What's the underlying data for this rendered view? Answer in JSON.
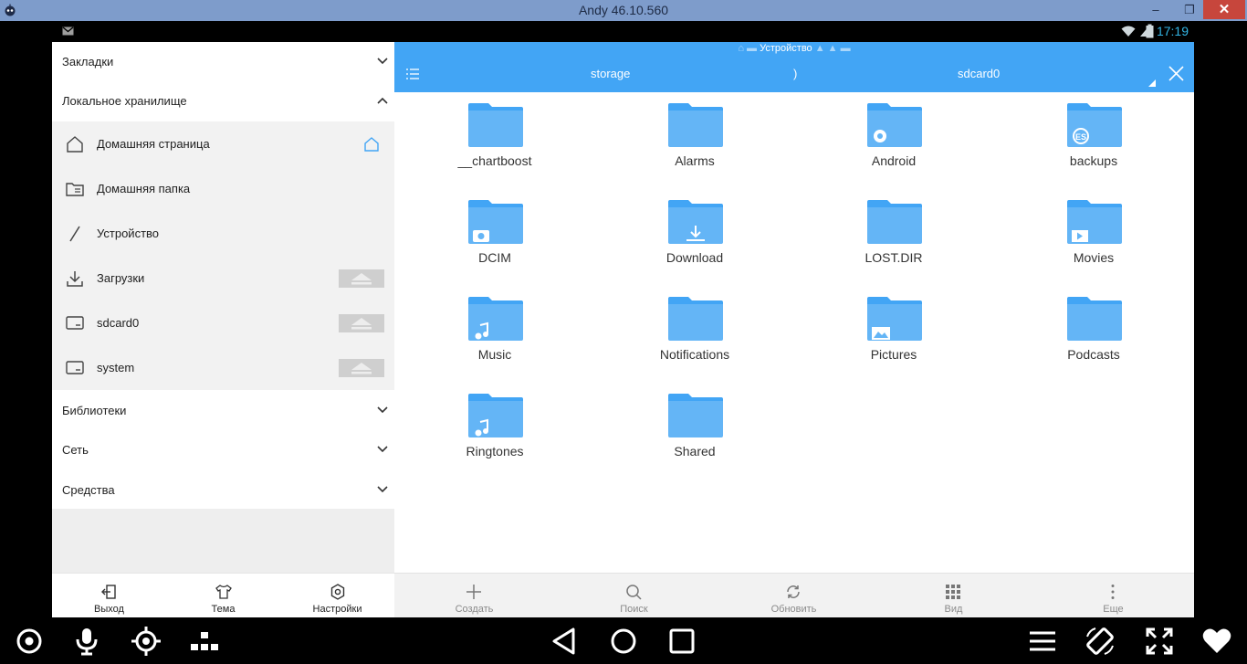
{
  "window": {
    "title": "Andy 46.10.560",
    "minimize": "–",
    "restore": "❐",
    "close": "✕"
  },
  "statusbar": {
    "time": "17:19"
  },
  "drawer": {
    "sections": [
      {
        "label": "Закладки",
        "expanded": false
      },
      {
        "label": "Локальное хранилище",
        "expanded": true
      },
      {
        "label": "Библиотеки",
        "expanded": false
      },
      {
        "label": "Сеть",
        "expanded": false
      },
      {
        "label": "Средства",
        "expanded": false
      }
    ],
    "items": [
      {
        "label": "Домашняя страница",
        "icon": "home-icon"
      },
      {
        "label": "Домашняя папка",
        "icon": "home-folder-icon"
      },
      {
        "label": "Устройство",
        "icon": "slash-icon"
      },
      {
        "label": "Загрузки",
        "icon": "download-icon"
      },
      {
        "label": "sdcard0",
        "icon": "sdcard-icon"
      },
      {
        "label": "system",
        "icon": "sdcard-icon"
      }
    ],
    "bottom": [
      {
        "label": "Выход",
        "icon": "exit-icon"
      },
      {
        "label": "Тема",
        "icon": "shirt-icon"
      },
      {
        "label": "Настройки",
        "icon": "gear-icon"
      }
    ]
  },
  "main": {
    "crumb": "Устройство",
    "path": [
      "storage",
      "sdcard0"
    ],
    "path_separator": ")",
    "folders": [
      {
        "name": "__chartboost",
        "badge": ""
      },
      {
        "name": "Alarms",
        "badge": ""
      },
      {
        "name": "Android",
        "badge": "gear"
      },
      {
        "name": "backups",
        "badge": "es"
      },
      {
        "name": "DCIM",
        "badge": "camera"
      },
      {
        "name": "Download",
        "badge": "download"
      },
      {
        "name": "LOST.DIR",
        "badge": ""
      },
      {
        "name": "Movies",
        "badge": "play"
      },
      {
        "name": "Music",
        "badge": "note"
      },
      {
        "name": "Notifications",
        "badge": ""
      },
      {
        "name": "Pictures",
        "badge": "image"
      },
      {
        "name": "Podcasts",
        "badge": ""
      },
      {
        "name": "Ringtones",
        "badge": "note"
      },
      {
        "name": "Shared",
        "badge": ""
      }
    ],
    "toolbar": [
      {
        "label": "Создать",
        "icon": "plus-icon"
      },
      {
        "label": "Поиск",
        "icon": "search-icon"
      },
      {
        "label": "Обновить",
        "icon": "refresh-icon"
      },
      {
        "label": "Вид",
        "icon": "grid-icon"
      },
      {
        "label": "Еще",
        "icon": "more-icon"
      }
    ]
  },
  "colors": {
    "accent": "#42a5f5",
    "folder": "#64b5f6",
    "folder_tab": "#42a5f5",
    "close": "#c7463c",
    "titlebar": "#7e9ccb"
  }
}
